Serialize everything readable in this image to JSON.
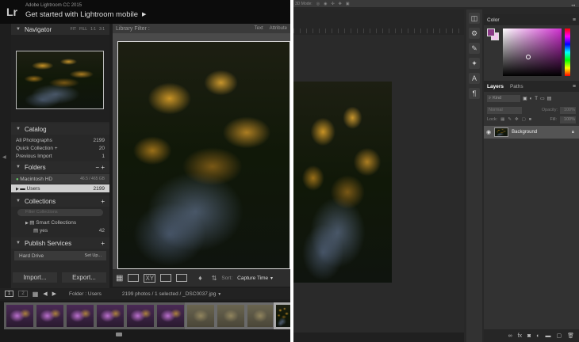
{
  "lightroom": {
    "app_title": "Adobe Lightroom CC 2015",
    "identity_plate": "Get started with Lightroom mobile",
    "logo": "Lr",
    "navigator": {
      "title": "Navigator",
      "zoom_options": [
        "FIT",
        "FILL",
        "1:1",
        "3:1"
      ]
    },
    "library_filter": {
      "title": "Library Filter :",
      "tabs": [
        "Text",
        "Attribute"
      ]
    },
    "catalog": {
      "title": "Catalog",
      "items": [
        {
          "label": "All Photographs",
          "count": "2199"
        },
        {
          "label": "Quick Collection +",
          "count": "20"
        },
        {
          "label": "Previous Import",
          "count": "1"
        }
      ]
    },
    "folders": {
      "title": "Folders",
      "volume": "Macintosh HD",
      "volume_info": "46.5 / 465 GB",
      "folder": "Users",
      "folder_count": "2199"
    },
    "collections": {
      "title": "Collections",
      "filter_placeholder": "Filter Collections",
      "items": [
        {
          "label": "Smart Collections",
          "count": ""
        },
        {
          "label": "yes",
          "count": "42"
        }
      ]
    },
    "publish": {
      "title": "Publish Services",
      "hard_drive": "Hard Drive",
      "setup": "Set Up..."
    },
    "import_button": "Import...",
    "export_button": "Export...",
    "sort_label": "Sort:",
    "sort_value": "Capture Time",
    "filmstrip": {
      "pages": [
        "1",
        "2"
      ],
      "path": "Folder : Users",
      "info": "2199 photos / 1 selected / _DSC0037.jpg"
    }
  },
  "photoshop": {
    "mode_label": "3D Mode:",
    "color_panel": {
      "title": "Color",
      "foreground": "#8a3a86",
      "background": "#f2c7ee"
    },
    "layers_panel": {
      "tabs": [
        "Layers",
        "Paths"
      ],
      "kind_placeholder": "Kind",
      "blend_mode": "Normal",
      "opacity_label": "Opacity:",
      "opacity_value": "100%",
      "lock_label": "Lock:",
      "fill_label": "Fill:",
      "fill_value": "100%",
      "layer_name": "Background"
    }
  }
}
